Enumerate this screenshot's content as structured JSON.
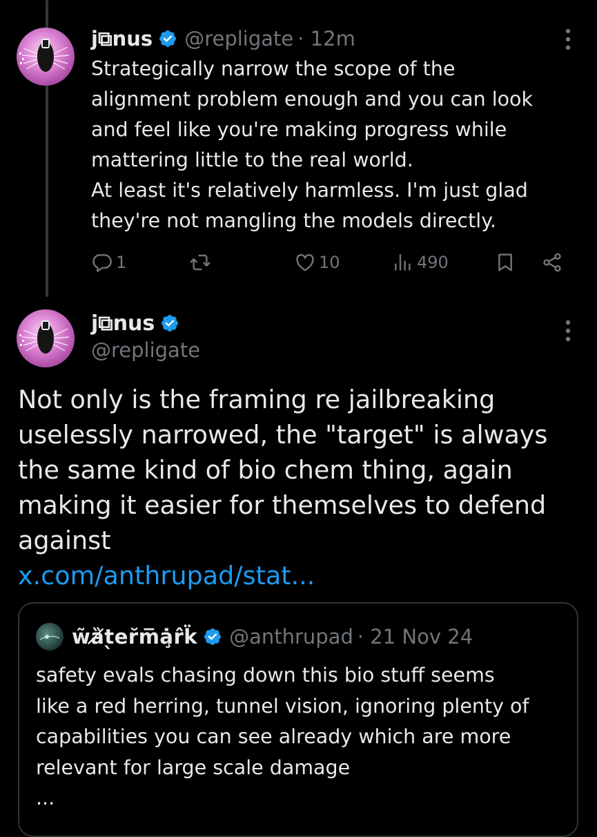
{
  "tweet1": {
    "author_name": "j⧉nus",
    "handle": "@repligate",
    "time": "· 12m",
    "lines": [
      "Strategically narrow the scope of the",
      "alignment problem enough and you can look",
      "and feel like you're making progress while",
      "mattering little to the real world.",
      "At least it's relatively harmless. I'm just glad",
      "they're not mangling the models directly."
    ],
    "actions": {
      "replies": "1",
      "likes": "10",
      "views": "490"
    },
    "icons": [
      "reply-icon",
      "retweet-icon",
      "like-icon",
      "views-icon",
      "bookmark-icon",
      "share-icon"
    ]
  },
  "tweet2": {
    "author_name": "j⧉nus",
    "handle": "@repligate",
    "lines": [
      "Not only is the framing re jailbreaking",
      "uselessly narrowed, the \"target\" is always",
      "the same kind of bio chem thing, again",
      "making it easier for themselves to defend",
      "against"
    ],
    "link": "x.com/anthrupad/stat..."
  },
  "quote": {
    "author_name": "w̃ȁ̸t̖e̵r̆m̅ȧ̧r̂k̈",
    "handle": "@anthrupad",
    "date": "· 21 Nov 24",
    "lines": [
      "safety evals chasing down this bio stuff seems",
      "like a red herring, tunnel vision, ignoring plenty of",
      "capabilities you can see already which are more",
      "relevant for large scale damage"
    ],
    "ellipsis": "..."
  },
  "colors": {
    "background": "#000000",
    "text": "#e7e9ea",
    "muted": "#71767b",
    "link": "#1d9bf0",
    "verified": "#1d9bf0",
    "border": "#2f3336"
  }
}
